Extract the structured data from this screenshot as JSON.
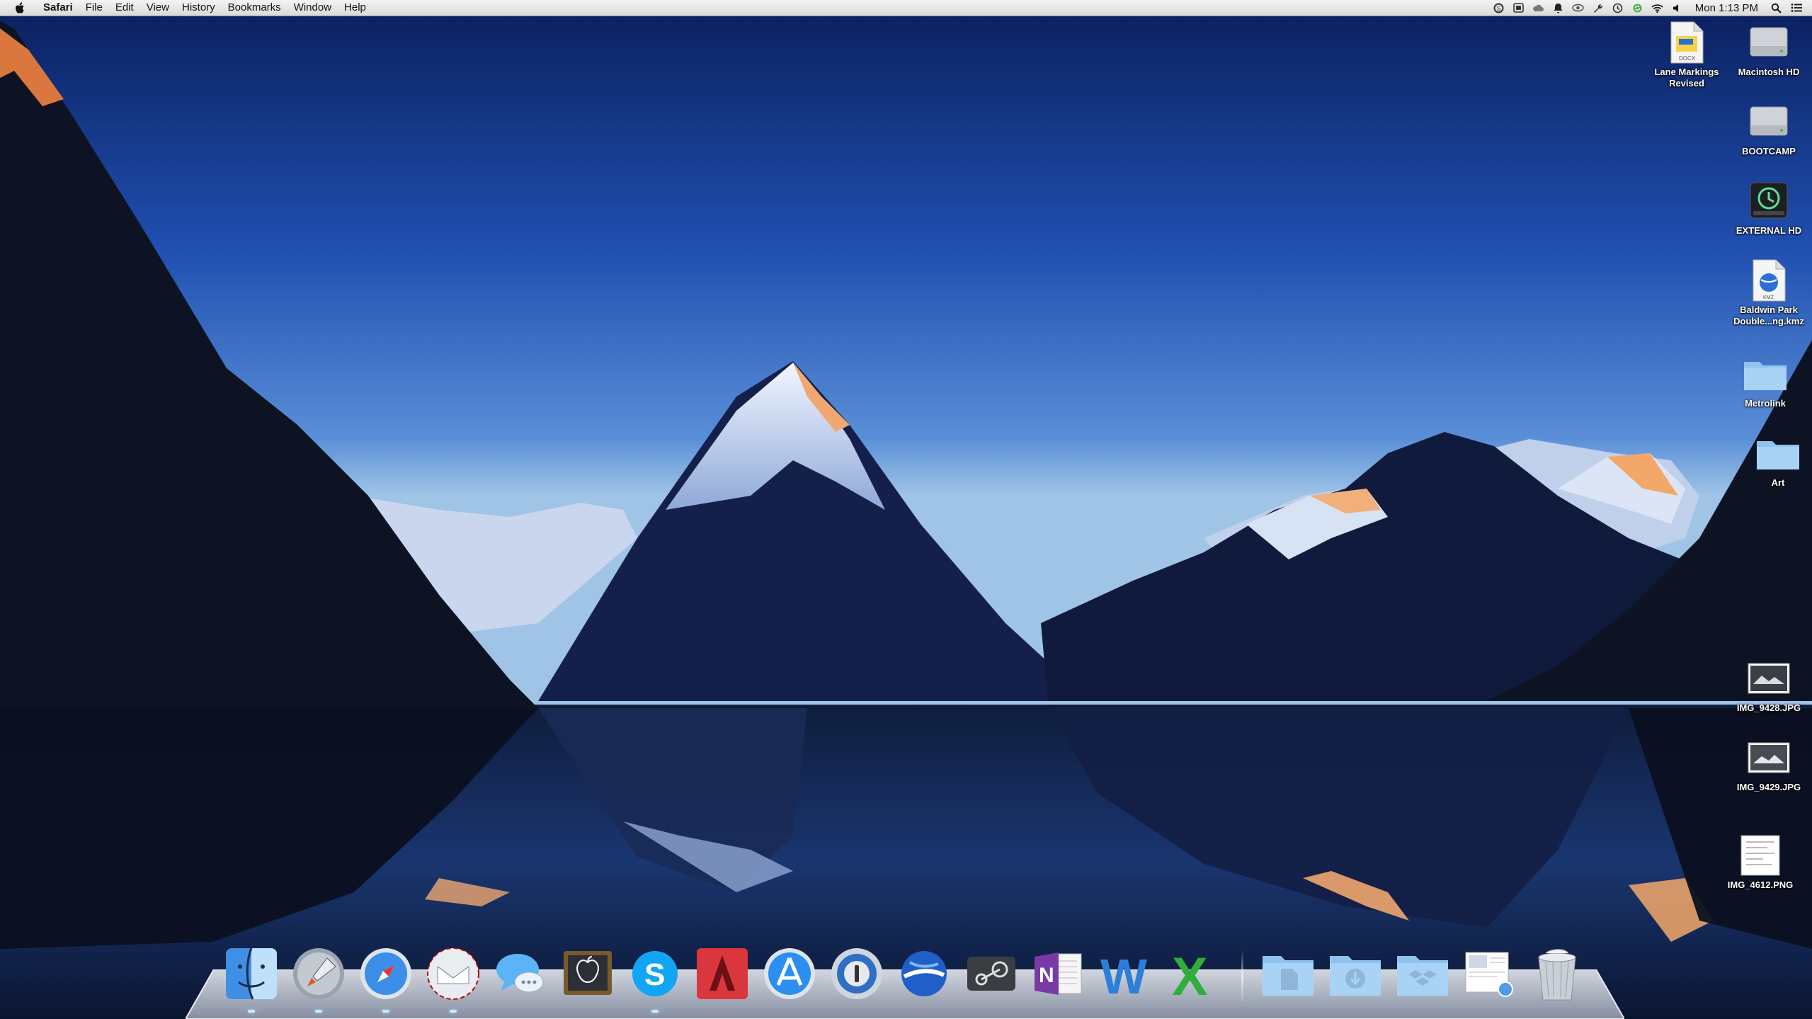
{
  "menubar": {
    "app_name": "Safari",
    "menus": [
      "File",
      "Edit",
      "View",
      "History",
      "Bookmarks",
      "Window",
      "Help"
    ],
    "status_icons": [
      "skype-status-icon",
      "app-status-icon",
      "cloud-status-icon",
      "bell-status-icon",
      "eye-status-icon",
      "wrench-status-icon",
      "time-machine-status-icon",
      "sync-status-icon",
      "wifi-icon",
      "volume-icon"
    ],
    "clock": "Mon 1:13 PM"
  },
  "desktop": {
    "icons": [
      {
        "label": "Lane Markings\nRevised",
        "icon": "docx-file-icon"
      },
      {
        "label": "Macintosh HD",
        "icon": "hard-drive-icon"
      },
      {
        "label": "BOOTCAMP",
        "icon": "hard-drive-icon"
      },
      {
        "label": "EXTERNAL HD",
        "icon": "time-machine-drive-icon"
      },
      {
        "label": "Baldwin Park\nDouble...ng.kmz",
        "icon": "kmz-file-icon"
      },
      {
        "label": "Metrolink",
        "icon": "folder-icon"
      },
      {
        "label": "Art",
        "icon": "folder-icon"
      },
      {
        "label": "IMG_9428.JPG",
        "icon": "image-thumbnail-icon"
      },
      {
        "label": "IMG_9429.JPG",
        "icon": "image-thumbnail-icon"
      },
      {
        "label": "IMG_4612.PNG",
        "icon": "image-thumbnail-icon"
      }
    ]
  },
  "dock": {
    "apps": [
      {
        "name": "Finder",
        "icon": "finder-icon"
      },
      {
        "name": "Launchpad",
        "icon": "launchpad-icon"
      },
      {
        "name": "Safari",
        "icon": "safari-icon"
      },
      {
        "name": "Mail",
        "icon": "mail-icon"
      },
      {
        "name": "Messages",
        "icon": "messages-icon"
      },
      {
        "name": "Keynote",
        "icon": "keynote-icon"
      },
      {
        "name": "Skype",
        "icon": "skype-icon"
      },
      {
        "name": "AutoCAD",
        "icon": "autocad-icon"
      },
      {
        "name": "App Store",
        "icon": "app-store-icon"
      },
      {
        "name": "1Password",
        "icon": "1password-icon"
      },
      {
        "name": "Google Earth",
        "icon": "google-earth-icon"
      },
      {
        "name": "Steam",
        "icon": "steam-icon"
      },
      {
        "name": "OneNote",
        "icon": "onenote-icon"
      },
      {
        "name": "Word",
        "icon": "word-icon"
      },
      {
        "name": "Excel",
        "icon": "excel-icon"
      }
    ],
    "stacks": [
      {
        "name": "Documents",
        "icon": "documents-stack-icon"
      },
      {
        "name": "Downloads",
        "icon": "downloads-stack-icon"
      },
      {
        "name": "Dropbox",
        "icon": "dropbox-stack-icon"
      },
      {
        "name": "Preview",
        "icon": "preview-stack-icon"
      },
      {
        "name": "Trash",
        "icon": "trash-icon"
      }
    ]
  }
}
